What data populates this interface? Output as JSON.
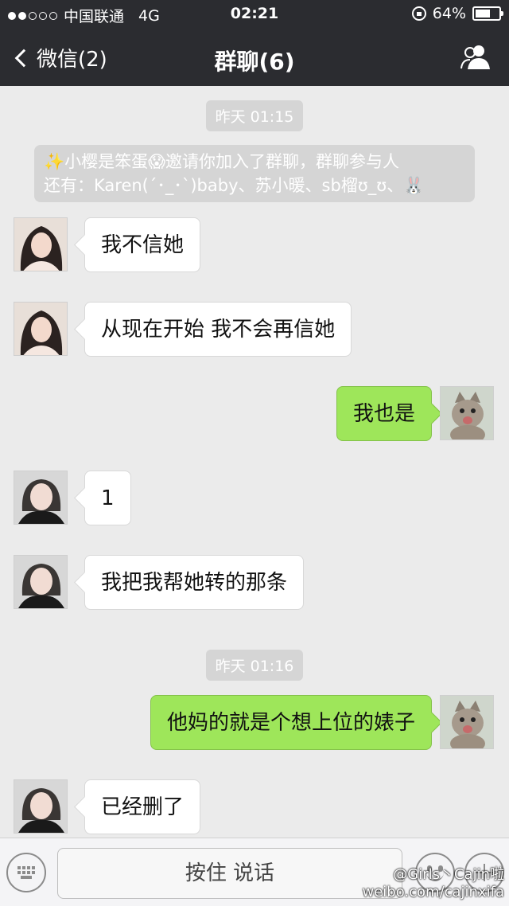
{
  "status_bar": {
    "carrier": "中国联通",
    "network": "4G",
    "time": "02:21",
    "battery": "64%",
    "battery_level": 0.64,
    "signal_bars_filled": 2,
    "signal_bars_total": 5
  },
  "nav": {
    "back_label": "微信(2)",
    "title": "群聊(6)"
  },
  "chat": {
    "timestamps": [
      "昨天 01:15",
      "昨天 01:16"
    ],
    "system_message_line1": "✨小樱是笨蛋😱邀请你加入了群聊，群聊参与人",
    "system_message_line2": "还有：Karen(´･_･`)baby、苏小暖、sb榴ʊ_ʊ、🐰",
    "messages": [
      {
        "from": "other",
        "sender": "member-a",
        "text": "我不信她"
      },
      {
        "from": "other",
        "sender": "member-a",
        "text": "从现在开始 我不会再信她"
      },
      {
        "from": "self",
        "text": "我也是"
      },
      {
        "from": "other",
        "sender": "member-b",
        "text": "1"
      },
      {
        "from": "other",
        "sender": "member-b",
        "text": "我把我帮她转的那条"
      },
      {
        "from": "self",
        "text": "他妈的就是个想上位的婊子"
      },
      {
        "from": "other",
        "sender": "member-b",
        "text": "已经删了"
      }
    ]
  },
  "input_bar": {
    "hold_to_talk": "按住 说话"
  },
  "watermark": {
    "line1": "@Girls丶Cajin啦",
    "line2": "weibo.com/cajinxifa"
  },
  "colors": {
    "topbar": "#2b2c30",
    "chat_bg": "#ebebeb",
    "outgoing_bubble": "#9ee65a",
    "incoming_bubble": "#ffffff",
    "system_bubble": "#d5d5d5"
  }
}
